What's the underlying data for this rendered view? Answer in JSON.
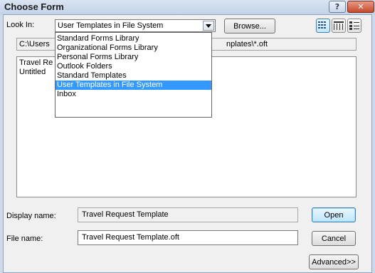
{
  "window": {
    "title": "Choose Form",
    "help_label": "?",
    "close_label": "✕"
  },
  "look_in": {
    "label": "Look In:",
    "value": "User Templates in File System"
  },
  "browse_label": "Browse...",
  "view_buttons": [
    "list-view-icon",
    "details-view-icon",
    "properties-view-icon"
  ],
  "path": {
    "left": "C:\\Users",
    "right": "nplates\\*.oft"
  },
  "list_items": [
    "Travel Re",
    "Untitled"
  ],
  "dropdown": {
    "items": [
      "Standard Forms Library",
      "Organizational Forms Library",
      "Personal Forms Library",
      "Outlook Folders",
      "Standard Templates",
      "User Templates in File System",
      "Inbox"
    ],
    "selected": "User Templates in File System"
  },
  "display_name": {
    "label": "Display name:",
    "value": "Travel Request Template"
  },
  "file_name": {
    "label": "File name:",
    "value": "Travel Request Template.oft"
  },
  "buttons": {
    "open": "Open",
    "cancel": "Cancel",
    "advanced": "Advanced>>"
  },
  "colors": {
    "selection": "#3399ff",
    "title_bar": "#c3d3e7",
    "close_button": "#c54a2c",
    "dialog_bg": "#f0f0f0"
  }
}
